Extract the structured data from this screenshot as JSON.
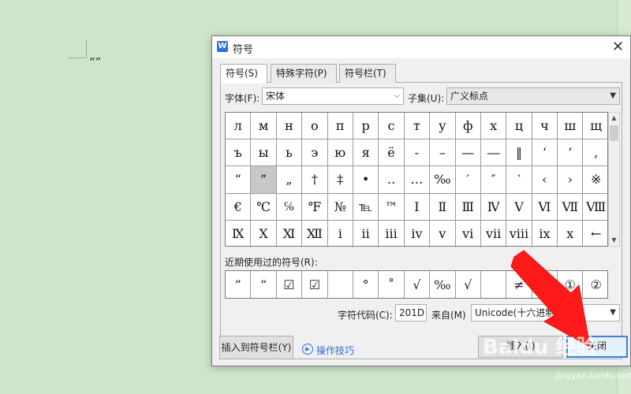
{
  "document": {
    "text": "“”"
  },
  "dialog": {
    "title": "符号",
    "icon_letter": "W",
    "close_glyph": "✕",
    "tabs": [
      "符号(S)",
      "特殊字符(P)",
      "符号栏(T)"
    ],
    "font_label": "字体(F):",
    "font_value": "宋体",
    "subset_label": "子集(U):",
    "subset_value": "广义标点",
    "grid": [
      [
        "л",
        "м",
        "н",
        "о",
        "п",
        "р",
        "с",
        "т",
        "у",
        "ф",
        "х",
        "ц",
        "ч",
        "ш",
        "щ"
      ],
      [
        "ъ",
        "ы",
        "ь",
        "э",
        "ю",
        "я",
        "ё",
        "‐",
        "–",
        "—",
        "―",
        "‖",
        "‘",
        "’",
        "‚"
      ],
      [
        "“",
        "”",
        "„",
        "†",
        "‡",
        "•",
        "‥",
        "…",
        "‰",
        "′",
        "″",
        "‵",
        "‹",
        "›",
        "※"
      ],
      [
        "€",
        "℃",
        "℅",
        "℉",
        "№",
        "℡",
        "™",
        "Ⅰ",
        "Ⅱ",
        "Ⅲ",
        "Ⅳ",
        "Ⅴ",
        "Ⅵ",
        "Ⅶ",
        "Ⅷ"
      ],
      [
        "Ⅸ",
        "Ⅹ",
        "Ⅺ",
        "Ⅻ",
        "ⅰ",
        "ⅱ",
        "ⅲ",
        "ⅳ",
        "ⅴ",
        "ⅵ",
        "ⅶ",
        "ⅷ",
        "ⅸ",
        "ⅹ",
        "←"
      ]
    ],
    "selected_symbol": "”",
    "recent_label": "近期使用过的符号(R):",
    "recent": [
      "”",
      "“",
      "☑",
      "☑",
      "",
      "°",
      "˚",
      "√",
      "‰",
      "√",
      "",
      "≠",
      "√",
      "①",
      "②"
    ],
    "code_label": "字符代码(C):",
    "code_value": "201D",
    "from_label": "来自(M)",
    "from_value": "Unicode(十六进制)",
    "insert_to_bar_button": "插入到符号栏(Y)",
    "tips_link": "操作技巧",
    "insert_button": "插入(I)",
    "close_button": "关闭"
  },
  "watermark": {
    "main": "Baidu 经验",
    "sub": "jingyan.baidu.com"
  },
  "colors": {
    "annotation_arrow": "#ff1a1a",
    "page_bg": "#cde6c9",
    "link": "#2f6fdc"
  }
}
